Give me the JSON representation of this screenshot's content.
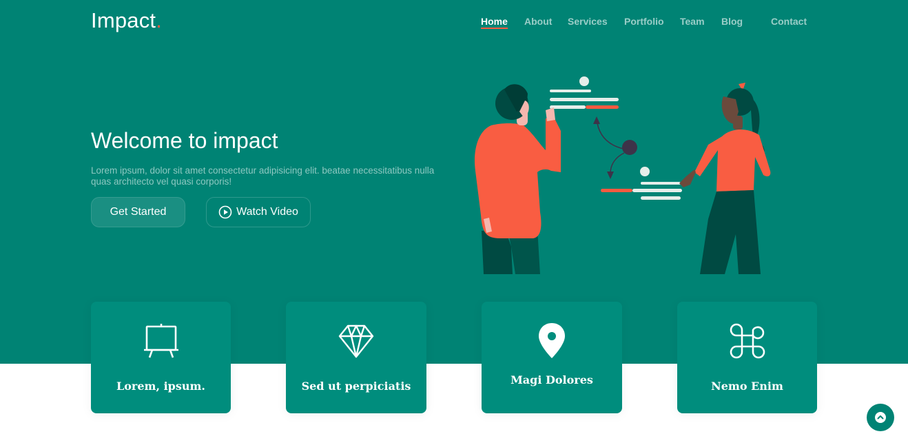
{
  "brand": {
    "name": "Impact",
    "dot": "."
  },
  "nav": {
    "items": [
      {
        "label": "Home",
        "active": true
      },
      {
        "label": "About"
      },
      {
        "label": "Services"
      },
      {
        "label": "Portfolio"
      },
      {
        "label": "Team"
      },
      {
        "label": "Blog"
      },
      {
        "label": "Contact"
      }
    ]
  },
  "hero": {
    "title": "Welcome to impact",
    "text": "Lorem ipsum, dolor sit amet consectetur adipisicing elit. beatae necessitatibus nulla quas architecto vel quasi corporis!",
    "primary_button": "Get Started",
    "secondary_button": "Watch Video",
    "secondary_button_icon": "play-circle-icon"
  },
  "cards": [
    {
      "title": "Lorem, ipsum.",
      "icon": "easel-icon"
    },
    {
      "title": "Sed ut perpiciatis",
      "icon": "gem-icon"
    },
    {
      "title": "Magi Dolores",
      "icon": "geo-pin-icon"
    },
    {
      "title": "Nemo Enim",
      "icon": "command-icon"
    }
  ],
  "scroll_top_icon": "arrow-up-short-icon",
  "colors": {
    "primary": "#008374",
    "card": "#008d7d",
    "accent": "#f85a40",
    "dark_figure": "#004a42"
  }
}
